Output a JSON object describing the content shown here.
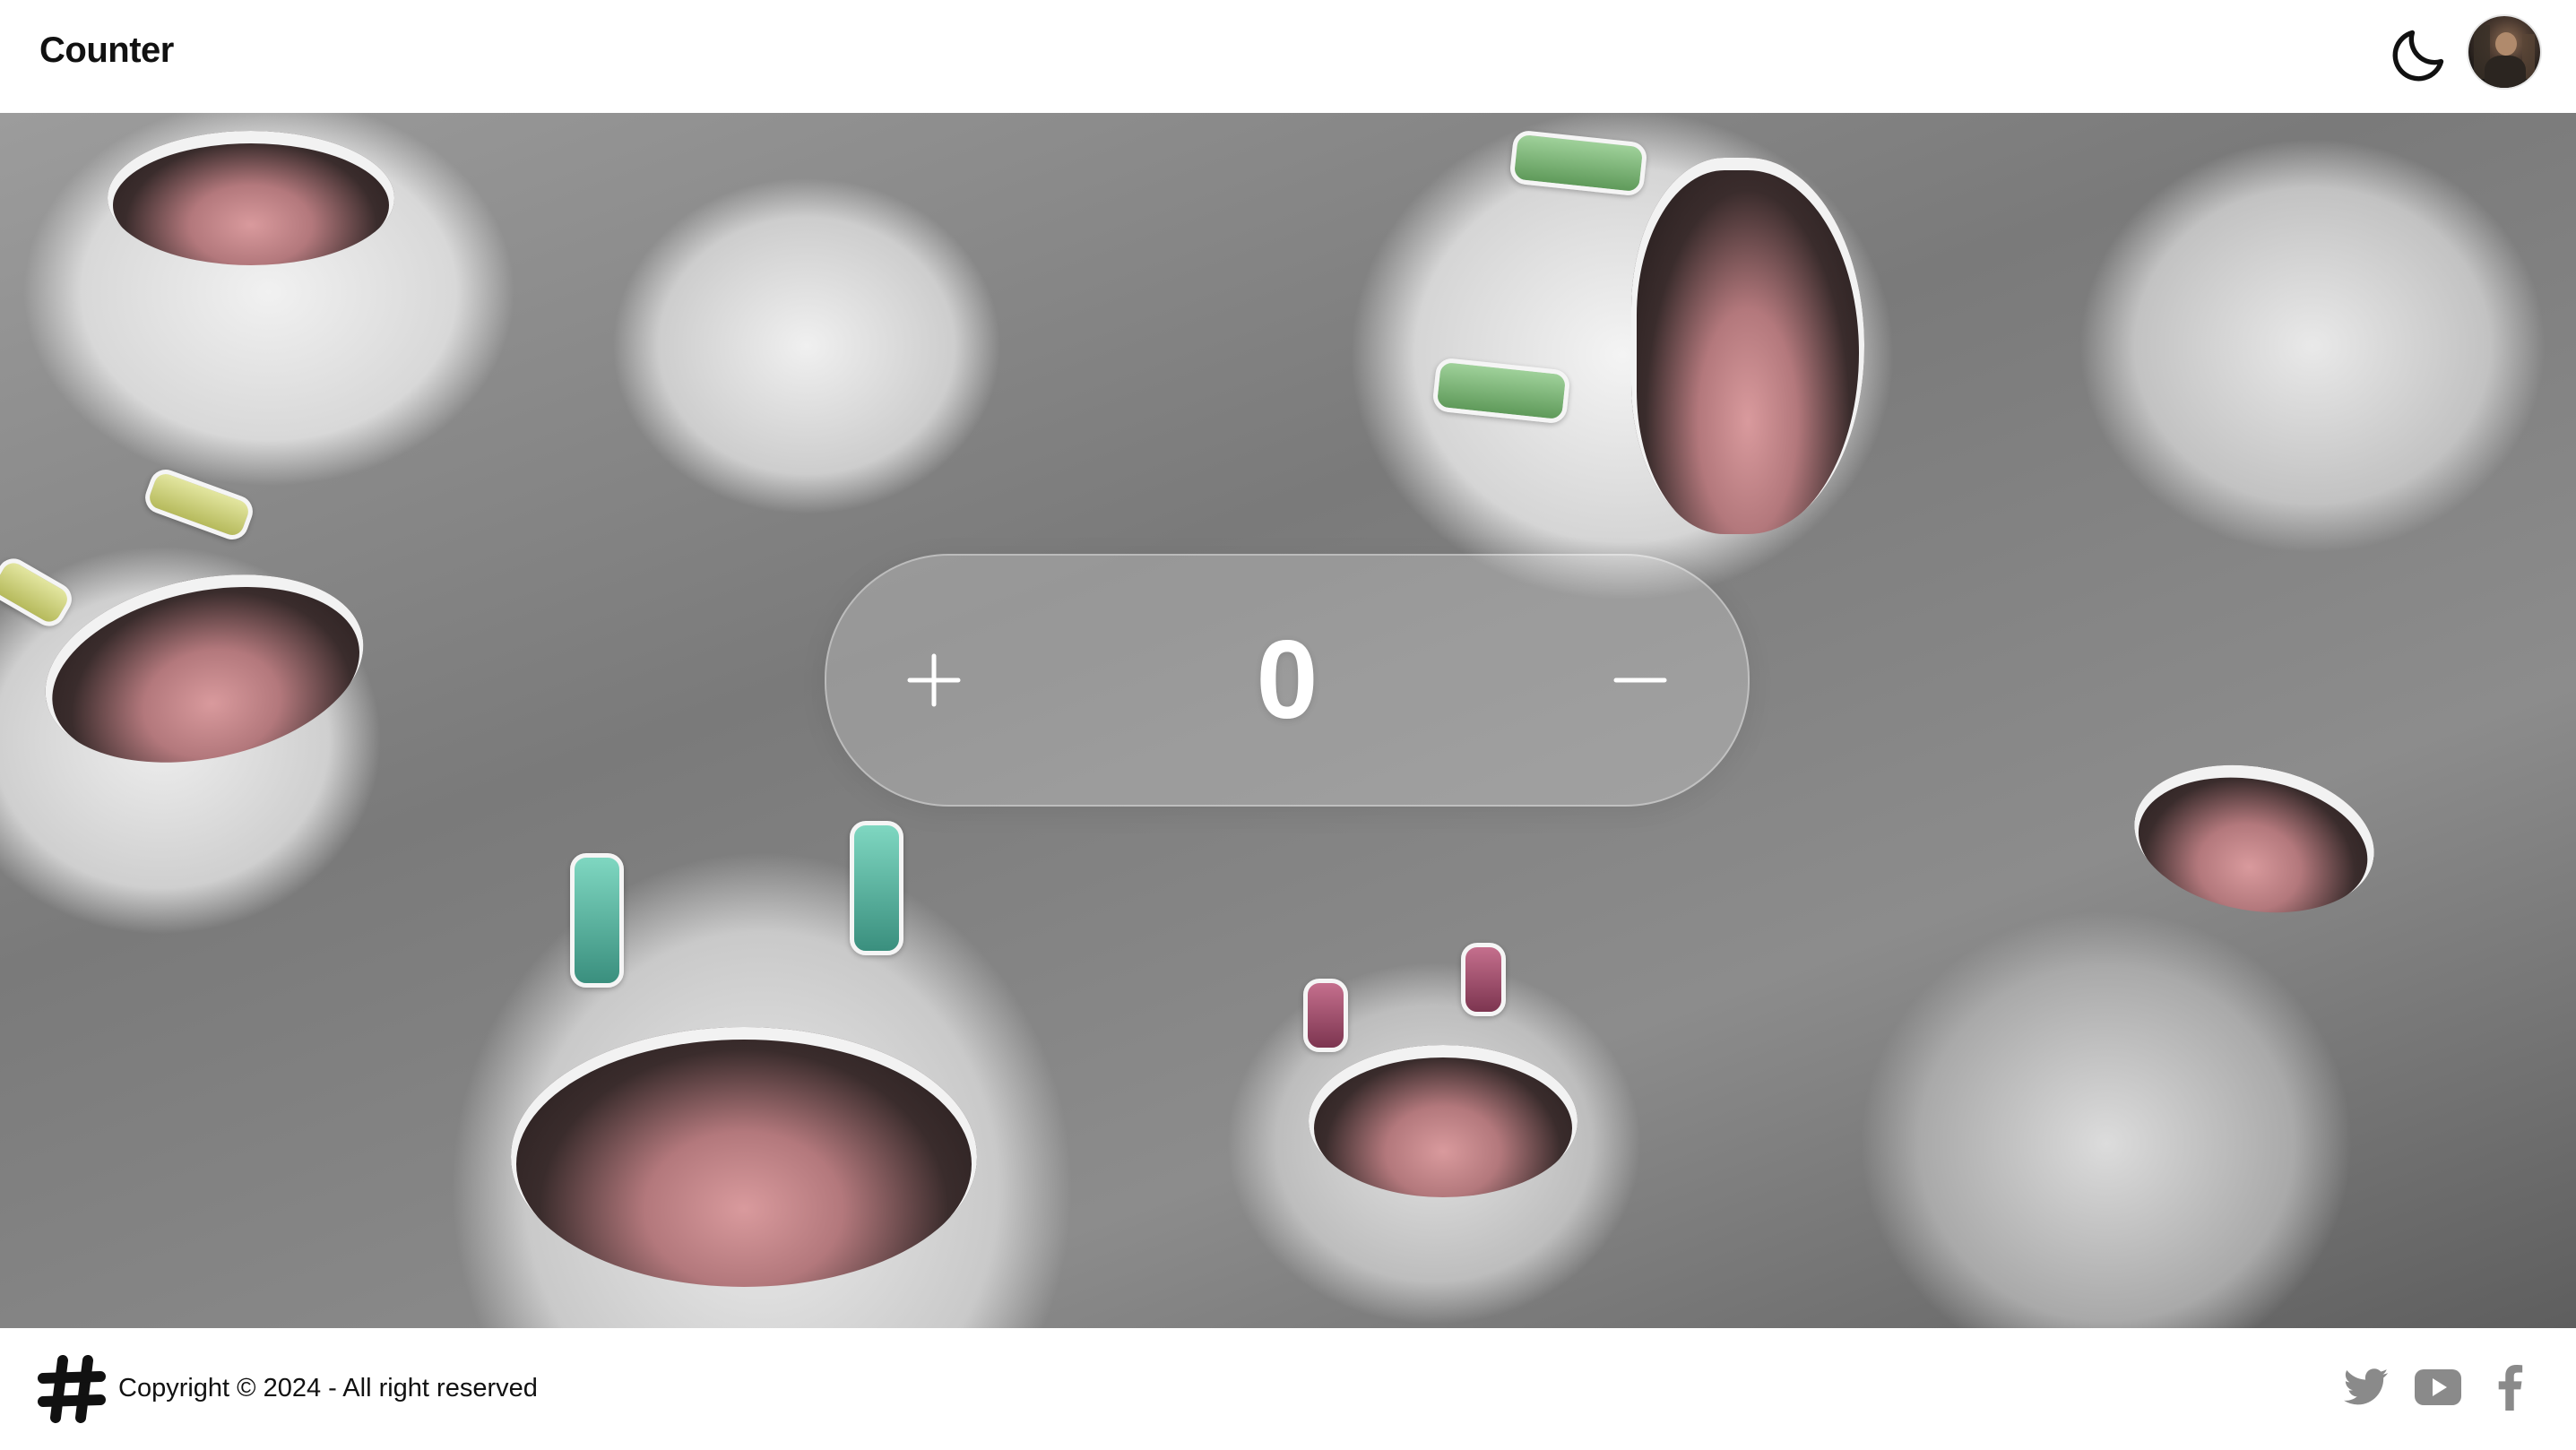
{
  "header": {
    "title": "Counter",
    "theme_toggle_icon": "moon-icon",
    "avatar_icon": "avatar"
  },
  "counter": {
    "value": "0",
    "increment_label": "+",
    "decrement_label": "−",
    "increment_icon": "plus-icon",
    "decrement_icon": "minus-icon"
  },
  "footer": {
    "logo_icon": "hash-logo-icon",
    "copyright": "Copyright © 2024 - All right reserved",
    "social": [
      {
        "icon": "twitter-icon"
      },
      {
        "icon": "youtube-icon"
      },
      {
        "icon": "facebook-icon"
      }
    ]
  },
  "colors": {
    "text": "#111111",
    "icon_gray": "#8a8a8a",
    "panel_text": "#ffffff"
  }
}
